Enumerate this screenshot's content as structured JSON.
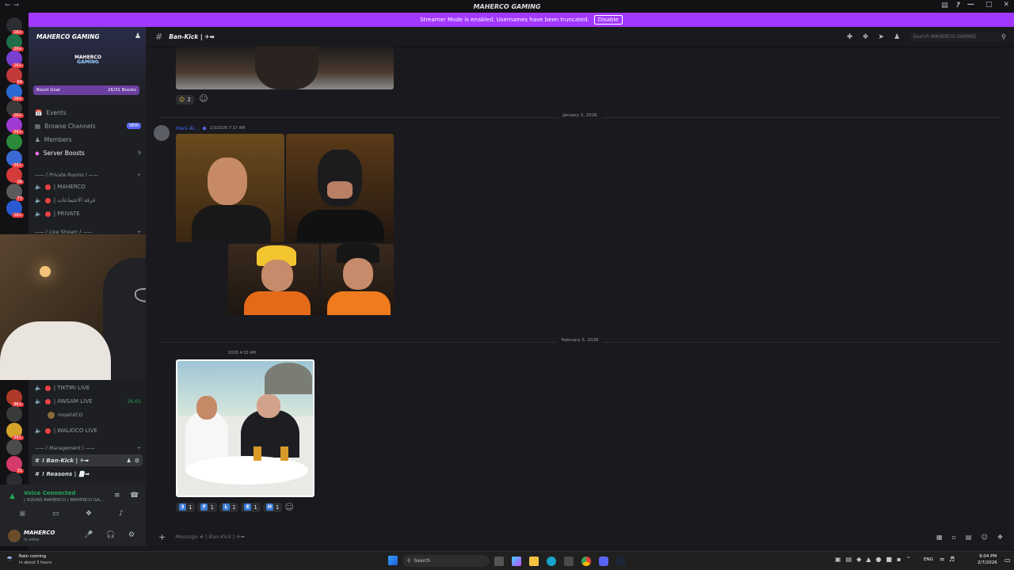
{
  "window": {
    "title": "MAHERCO GAMING"
  },
  "banner": {
    "text": "Streamer Mode is enabled. Usernames have been truncated.",
    "button": "Disable"
  },
  "guilds": [
    {
      "badge": "1K+"
    },
    {
      "badge": "2K+"
    },
    {
      "badge": "1K+"
    },
    {
      "badge": "64"
    },
    {
      "badge": "1K+"
    },
    {
      "badge": "2K+"
    },
    {
      "badge": "5K+"
    },
    {
      "badge": ""
    },
    {
      "badge": "5K+"
    },
    {
      "badge": "26"
    },
    {
      "badge": "77"
    },
    {
      "badge": "1K+"
    },
    {
      "badge": "9K+"
    },
    {
      "badge": ""
    },
    {
      "badge": "5K+"
    },
    {
      "badge": ""
    },
    {
      "badge": "31"
    },
    {
      "badge": "NEW"
    }
  ],
  "server": {
    "name": "MAHERCO GAMING",
    "logo_line1": "MAHERCO",
    "logo_line2": "GAMING",
    "boost_label": "Boost Goal",
    "boost_count": "26/31 Boosts"
  },
  "nav": {
    "events": "Events",
    "browse": "Browse Channels",
    "browse_badge": "NEW",
    "members": "Members",
    "boosts": "Server Boosts",
    "boosts_count": "9"
  },
  "categories": {
    "private": "—— ( Private Rooms ) ——",
    "live": "—— ( Live Stream ) ——",
    "management": "—— ( Management ) ——"
  },
  "voice_channels": {
    "maherco": "| MAHERCO",
    "meeting": "| غرفة الاجتماعات",
    "private": "| PRIVATE",
    "tiktiri": "| TIKTIRI LIVE",
    "awsam": "| AWSAM LIVE",
    "awsam_timer": "26:01",
    "awsam_user": "mojahdCO",
    "walidco": "| WALIDCO LIVE"
  },
  "text_channels": {
    "bankick": "! Ban-Kick | ✈➡",
    "reasons": "! Reasons | 📄➡"
  },
  "voice_status": {
    "title": "Voice Connected",
    "channel": "| SQUAD MAHERCO | MAHERCO GA..."
  },
  "user": {
    "name": "MAHERCO",
    "status": "In voice"
  },
  "header": {
    "channel": "Ban-Kick | ✈➡",
    "search_placeholder": "Search MAHERCO GAMING"
  },
  "messages": {
    "reaction_first": "2",
    "divider1": "January 3, 2026",
    "author": "Hani Al...",
    "timestamp": "1/3/2026 7:17 AM",
    "divider2": "February 5, 2026",
    "timestamp2": "2026 4:33 AM",
    "reactions": [
      {
        "letter": "3",
        "count": "1"
      },
      {
        "letter": "F",
        "count": "1"
      },
      {
        "letter": "L",
        "count": "1"
      },
      {
        "letter": "E",
        "count": "1"
      },
      {
        "letter": "H",
        "count": "1"
      }
    ]
  },
  "composer": {
    "placeholder": "Message # | Ban-Kick | ✈➡"
  },
  "taskbar": {
    "weather": "Rain coming",
    "weather_sub": "In about 3 hours",
    "search": "Search",
    "lang": "ENG",
    "time": "9:04 PM",
    "date": "2/7/2026"
  },
  "colors": {
    "accent": "#a238ff",
    "brand": "#5865f2",
    "danger": "#ed4245",
    "success": "#23a55a"
  }
}
